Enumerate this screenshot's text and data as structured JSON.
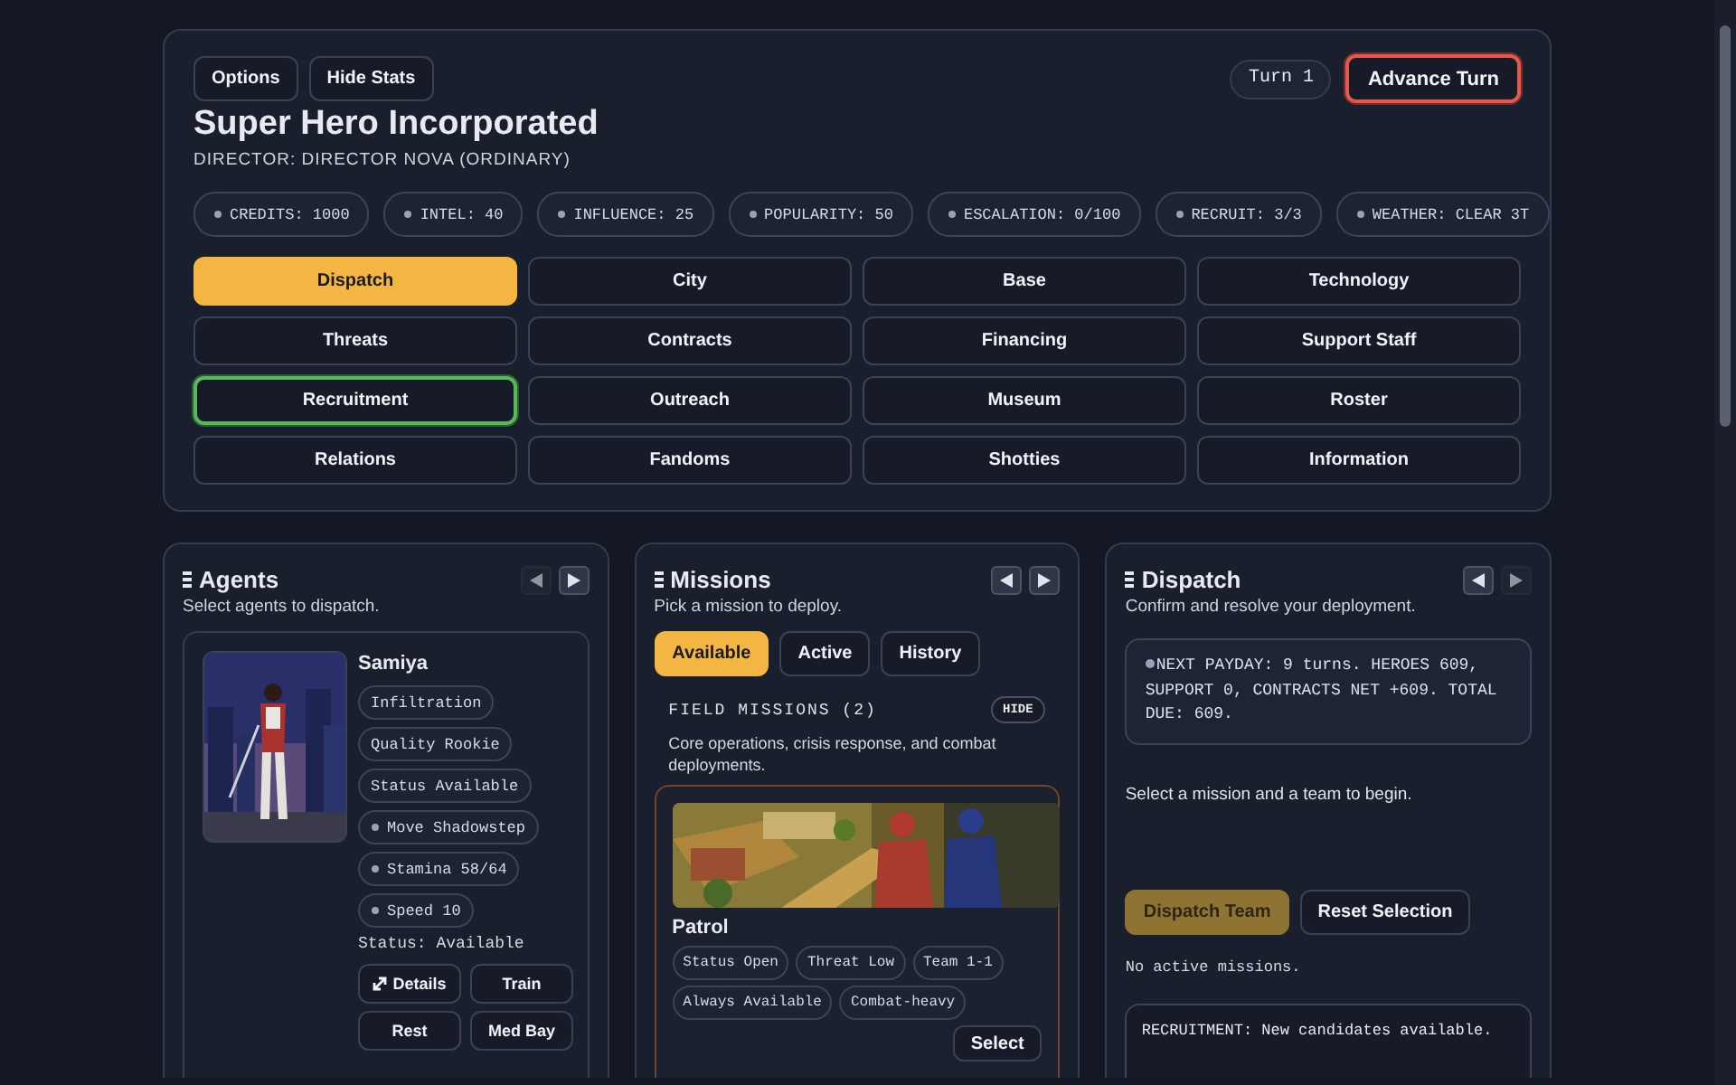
{
  "header": {
    "buttons": [
      "Options",
      "Hide Stats"
    ],
    "turn": "Turn 1",
    "advance_button": "Advance Turn",
    "title": "Super Hero Incorporated",
    "director": "DIRECTOR: DIRECTOR NOVA (ORDINARY)",
    "stats": [
      "CREDITS: 1000",
      "INTEL: 40",
      "INFLUENCE: 25",
      "POPULARITY: 50",
      "ESCALATION: 0/100",
      "RECRUIT: 3/3",
      "WEATHER: CLEAR 3T"
    ]
  },
  "nav": [
    {
      "label": "Dispatch",
      "selected": true,
      "focused": false
    },
    {
      "label": "City",
      "selected": false,
      "focused": false
    },
    {
      "label": "Base",
      "selected": false,
      "focused": false
    },
    {
      "label": "Technology",
      "selected": false,
      "focused": false
    },
    {
      "label": "Threats",
      "selected": false,
      "focused": false
    },
    {
      "label": "Contracts",
      "selected": false,
      "focused": false
    },
    {
      "label": "Financing",
      "selected": false,
      "focused": false
    },
    {
      "label": "Support Staff",
      "selected": false,
      "focused": false
    },
    {
      "label": "Recruitment",
      "selected": false,
      "focused": true
    },
    {
      "label": "Outreach",
      "selected": false,
      "focused": false
    },
    {
      "label": "Museum",
      "selected": false,
      "focused": false
    },
    {
      "label": "Roster",
      "selected": false,
      "focused": false
    },
    {
      "label": "Relations",
      "selected": false,
      "focused": false
    },
    {
      "label": "Fandoms",
      "selected": false,
      "focused": false
    },
    {
      "label": "Shotties",
      "selected": false,
      "focused": false
    },
    {
      "label": "Information",
      "selected": false,
      "focused": false
    }
  ],
  "agents": {
    "title": "Agents",
    "subtitle": "Select agents to dispatch.",
    "prev_disabled": true,
    "next_disabled": false,
    "agent": {
      "name": "Samiya",
      "tags": [
        {
          "text": "Infiltration",
          "kind": "plain"
        },
        {
          "text": "Quality Rookie",
          "kind": "plain"
        },
        {
          "text": "Status Available",
          "kind": "plain"
        },
        {
          "text": "Move Shadowstep",
          "kind": "icon"
        },
        {
          "text": "Stamina 58/64",
          "kind": "icon"
        },
        {
          "text": "Speed 10",
          "kind": "icon"
        }
      ],
      "status": "Status: Available",
      "buttons": [
        {
          "label": "Details",
          "kind": "expand"
        },
        {
          "label": "Train",
          "kind": "plain"
        },
        {
          "label": "Rest",
          "kind": "plain"
        },
        {
          "label": "Med Bay",
          "kind": "plain"
        }
      ]
    }
  },
  "missions": {
    "title": "Missions",
    "subtitle": "Pick a mission to deploy.",
    "prev_disabled": false,
    "next_disabled": false,
    "tabs": [
      {
        "label": "Available",
        "selected": true
      },
      {
        "label": "Active",
        "selected": false
      },
      {
        "label": "History",
        "selected": false
      }
    ],
    "section": {
      "title": "FIELD MISSIONS (2)",
      "hide_button": "HIDE",
      "description": "Core operations, crisis response, and combat deployments."
    },
    "mission": {
      "name": "Patrol",
      "tags": [
        "Status Open",
        "Threat Low",
        "Team 1-1",
        "Always Available",
        "Combat-heavy"
      ],
      "select_button": "Select"
    }
  },
  "dispatch": {
    "title": "Dispatch",
    "subtitle": "Confirm and resolve your deployment.",
    "prev_disabled": false,
    "next_disabled": true,
    "payday": "NEXT PAYDAY: 9 turns. HEROES 609, SUPPORT 0, CONTRACTS NET +609. TOTAL DUE: 609.",
    "prompt": "Select a mission and a team to begin.",
    "buttons": [
      {
        "label": "Dispatch Team",
        "disabled": true
      },
      {
        "label": "Reset Selection",
        "disabled": false
      }
    ],
    "active_missions": "No active missions.",
    "log": "RECRUITMENT: New candidates available."
  }
}
